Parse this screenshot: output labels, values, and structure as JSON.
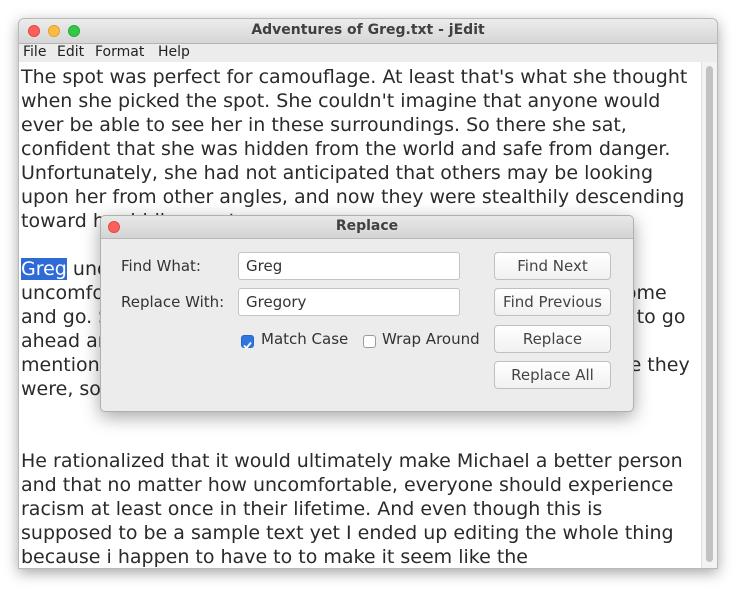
{
  "window": {
    "title": "Adventures of Greg.txt - jEdit"
  },
  "menu": [
    "File",
    "Edit",
    "Format",
    "Help"
  ],
  "editor": {
    "para1": "The spot was perfect for camouflage. At least that's what she thought when she picked the spot. She couldn't imagine that anyone would ever be able to see her in these surroundings. So there she sat, confident that she was hidden from the world and safe from danger. Unfortunately, she had not anticipated that others may be looking upon her from other angles, and now they were stealthily descending toward her hiding spot.",
    "para2_highlight": "Greg",
    "para2_rest": " understood that this situation would make Michael terribly uncomfortable. Michael simply had no idea how to make it go come and go. Since he didn't want to make him feel isolated,he opted to go ahead and say it. It wasn't the first time something Greg had mentioned bothered him. They were opposites at times, yet here they were, somehow still managing to stay bestfriends.",
    "para3": "He rationalized that it would ultimately make Michael a better person and that no matter how uncomfortable, everyone should experience racism at least once in their lifetime. And even though this is supposed to be a sample text yet I ended up editing the whole thing because i happen to have to to make it seem like the"
  },
  "dialog": {
    "title": "Replace",
    "find_label": "Find What:",
    "find_value": "Greg",
    "replace_label": "Replace With:",
    "replace_value": "Gregory",
    "match_case_label": "Match Case",
    "match_case_checked": true,
    "wrap_around_label": "Wrap Around",
    "wrap_around_checked": false,
    "buttons": {
      "find_next": "Find Next",
      "find_previous": "Find Previous",
      "replace": "Replace",
      "replace_all": "Replace All"
    }
  },
  "colors": {
    "selection": "#2f6bd6",
    "checkbox_on": "#2f76e0",
    "close_red": "#fc605b",
    "minimize_yellow": "#fdbc40",
    "zoom_green": "#34c84a"
  }
}
